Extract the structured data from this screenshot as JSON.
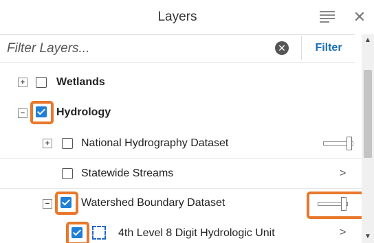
{
  "panel": {
    "title": "Layers"
  },
  "filter": {
    "placeholder": "Filter Layers...",
    "button_label": "Filter"
  },
  "layers": [
    {
      "label": "Wetlands",
      "checked": false,
      "expander": "+"
    },
    {
      "label": "Hydrology",
      "checked": true,
      "expander": "−"
    },
    {
      "label": "National Hydrography Dataset",
      "checked": false,
      "expander": "+",
      "opacity": 0.9
    },
    {
      "label": "Statewide Streams",
      "checked": false,
      "chevron": ">"
    },
    {
      "label": "Watershed Boundary Dataset",
      "checked": true,
      "expander": "−",
      "opacity": 0.9
    },
    {
      "label": "4th Level 8 Digit Hydrologic Unit",
      "checked": true,
      "chevron": ">"
    }
  ],
  "icons": {
    "menu": "hamburger-menu-icon",
    "close": "close-icon",
    "clear": "clear-search-icon",
    "expand": "expand-icon",
    "collapse": "collapse-icon",
    "chevron": "chevron-right-icon"
  },
  "colors": {
    "highlight": "#e8782b",
    "checkbox_checked": "#1f7fd6",
    "filter_button_text": "#1a6fb7"
  }
}
